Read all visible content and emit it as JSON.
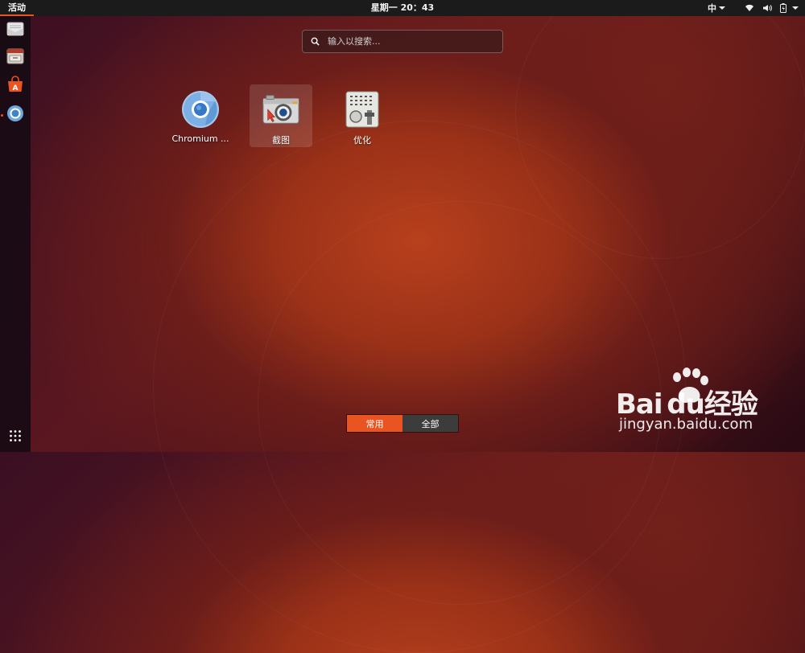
{
  "topbar": {
    "activities": "活动",
    "clock": "星期一 20：43",
    "input_method": "中"
  },
  "dock": {
    "items": [
      {
        "icon": "mail-icon"
      },
      {
        "icon": "files-icon"
      },
      {
        "icon": "software-center-icon"
      },
      {
        "icon": "chromium-icon",
        "running": true
      }
    ],
    "show_apps_icon": "grid-icon"
  },
  "search": {
    "placeholder": "输入以搜索..."
  },
  "apps": [
    {
      "label": "Chromium ...",
      "icon": "chromium-icon",
      "running": true
    },
    {
      "label": "截图",
      "icon": "camera-icon",
      "selected": true
    },
    {
      "label": "优化",
      "icon": "tweaks-icon"
    }
  ],
  "tabs": {
    "frequent": "常用",
    "all": "全部",
    "active": "frequent"
  },
  "watermark": {
    "brand": "Bai du经验",
    "url": "jingyan.baidu.com"
  },
  "colors": {
    "accent": "#e95420",
    "topbar": "#1b1b1b"
  }
}
